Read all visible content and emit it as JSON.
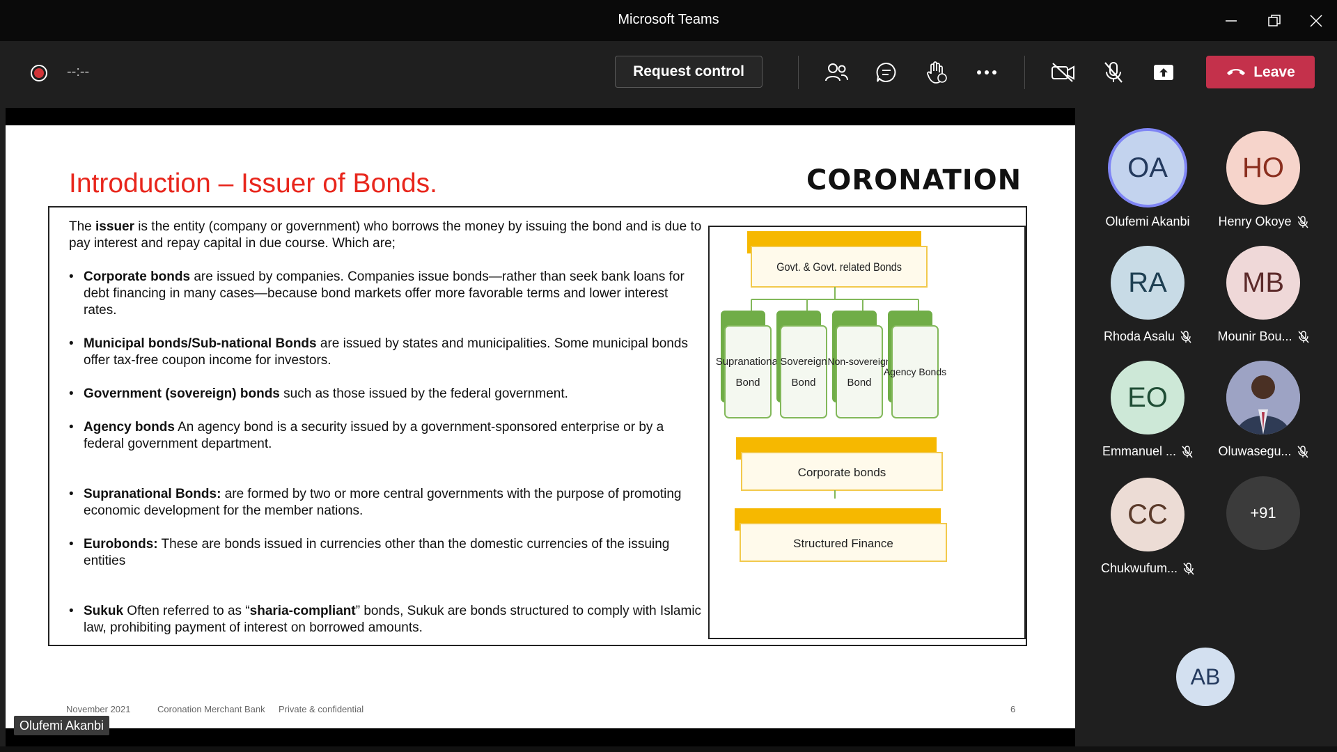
{
  "window": {
    "title": "Microsoft Teams"
  },
  "toolbar": {
    "timer": "--:--",
    "request_control_label": "Request control",
    "leave_label": "Leave",
    "icons": [
      "people-icon",
      "chat-icon",
      "raise-hand-icon",
      "more-icon",
      "camera-off-icon",
      "mic-off-icon",
      "share-icon"
    ]
  },
  "slide": {
    "title": "Introduction – Issuer of Bonds.",
    "logo_text": "CORONATION",
    "intro": {
      "prefix": "The ",
      "bold": "issuer",
      "rest": " is the entity (company or government) who borrows the money by issuing the bond and is due to pay interest and repay capital in due course. Which are;"
    },
    "bullets": [
      {
        "bold": "Corporate bonds",
        "text": " are issued by companies. Companies issue bonds—rather than seek bank loans for debt financing in many cases—because bond markets offer more favorable terms and lower interest rates."
      },
      {
        "bold": "Municipal bonds/Sub-national Bonds",
        "text": "  are issued by states and municipalities. Some municipal bonds offer tax-free coupon income for investors."
      },
      {
        "bold": "Government (sovereign) bonds",
        "text": " such as those issued by the federal government."
      },
      {
        "bold": "Agency bonds",
        "text": " An agency bond is a security issued by a government-sponsored enterprise or by a federal government department."
      },
      {
        "bold": "Supranational Bonds:",
        "text": " are formed by two or more central governments with the purpose of promoting economic development for the member nations."
      },
      {
        "bold": "Eurobonds:",
        "text": " These are bonds issued in currencies other than the domestic currencies of the issuing entities"
      },
      {
        "bold": "Sukuk",
        "text": " Often referred to as “",
        "bold2": "sharia-compliant",
        "text2": "” bonds, Sukuk are bonds structured to comply with Islamic law, prohibiting payment of interest on borrowed amounts."
      }
    ],
    "diagram": {
      "top": "Govt. & Govt. related Bonds",
      "children": [
        {
          "line1": "Supranational",
          "line2": "Bond"
        },
        {
          "line1": "Sovereign",
          "line2": "Bond"
        },
        {
          "line1": "Non-sovereign",
          "line2": "Bond"
        },
        {
          "line1": "Agency Bonds",
          "line2": ""
        }
      ],
      "middle": "Corporate bonds",
      "bottom": "Structured Finance",
      "colors": {
        "header_bar": "#f6b800",
        "child_tab": "#70ad47",
        "child_border": "#82b85a"
      }
    },
    "footer": {
      "date": "November 2021",
      "company": "Coronation Merchant Bank",
      "confidential": "Private & confidential",
      "page": "6"
    }
  },
  "presenter_tag": "Olufemi Akanbi",
  "participants": [
    {
      "initials": "OA",
      "name": "Olufemi Akanbi",
      "muted": false,
      "bg": "#c3d3ee",
      "fg": "#243a5e",
      "active": true
    },
    {
      "initials": "HO",
      "name": "Henry Okoye",
      "muted": true,
      "bg": "#f6d4cb",
      "fg": "#8a2e1e"
    },
    {
      "initials": "RA",
      "name": "Rhoda Asalu",
      "muted": true,
      "bg": "#c8dbe6",
      "fg": "#1e3f52"
    },
    {
      "initials": "MB",
      "name": "Mounir Bou...",
      "muted": true,
      "bg": "#efd8d8",
      "fg": "#5c2a2a"
    },
    {
      "initials": "EO",
      "name": "Emmanuel ...",
      "muted": true,
      "bg": "#cde8d7",
      "fg": "#1f4d35"
    },
    {
      "initials": "",
      "name": "Oluwasegu...",
      "muted": true,
      "bg": "#8a8fb0",
      "fg": "#ffffff",
      "photo": true
    },
    {
      "initials": "CC",
      "name": "Chukwufum...",
      "muted": true,
      "bg": "#ecdcd5",
      "fg": "#5a3a2a"
    },
    {
      "initials": "+91",
      "name": "",
      "muted": false,
      "bg": "#3b3b3b",
      "fg": "#ffffff"
    }
  ],
  "self_avatar": {
    "initials": "AB",
    "bg": "#d3e0f0",
    "fg": "#243a5e"
  }
}
